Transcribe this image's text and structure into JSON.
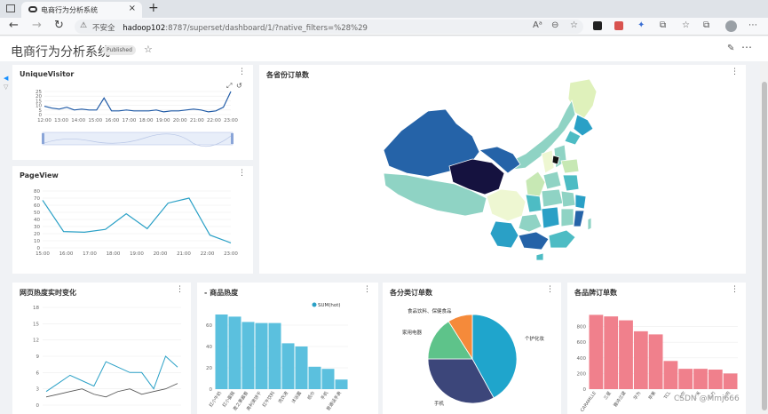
{
  "browser": {
    "tab_title": "电商行为分析系统",
    "tab_close": "×",
    "new_tab": "+",
    "insecure_label": "不安全",
    "url_host": "hadoop102",
    "url_path": ":8787/superset/dashboard/1/?native_filters=%28%29",
    "nav_back": "←",
    "nav_forward": "→",
    "nav_reload": "↻"
  },
  "dashboard": {
    "title": "电商行为分析系统",
    "status_badge": "Published",
    "star_icon": "☆",
    "edit_icon": "✎",
    "menu_icon": "⋯"
  },
  "menu_icon": "⋮",
  "charts": {
    "unique_visitor": {
      "title": "UniqueVisitor",
      "type": "line",
      "x": [
        "12:00",
        "13:00",
        "14:00",
        "15:00",
        "16:00",
        "17:00",
        "18:00",
        "19:00",
        "20:00",
        "21:00",
        "22:00",
        "23:00"
      ],
      "y_ticks": [
        "25",
        "20",
        "15",
        "10",
        "5",
        "0"
      ],
      "ylim": [
        0,
        25
      ],
      "values": [
        9,
        7,
        6,
        8,
        5,
        6,
        5,
        5,
        18,
        4,
        4,
        5,
        4,
        4,
        4,
        5,
        3,
        4,
        4,
        5,
        6,
        5,
        3,
        4,
        8,
        25
      ],
      "toolbox": [
        "⤢",
        "↺"
      ],
      "has_zoom_slider": true
    },
    "page_view": {
      "title": "PageView",
      "type": "line",
      "x": [
        "15:00",
        "16:00",
        "17:00",
        "18:00",
        "19:00",
        "20:00",
        "21:00",
        "22:00",
        "23:00"
      ],
      "y_ticks": [
        "80",
        "70",
        "60",
        "50",
        "40",
        "30",
        "20",
        "10",
        "0"
      ],
      "ylim": [
        0,
        80
      ],
      "values": [
        67,
        23,
        22,
        26,
        48,
        27,
        63,
        70,
        18,
        7
      ]
    },
    "province_orders": {
      "title": "各省份订单数",
      "type": "map"
    },
    "page_heat": {
      "title": "网页热度实时变化",
      "type": "line",
      "y_ticks": [
        "18",
        "15",
        "12",
        "9",
        "6",
        "3",
        "0"
      ],
      "ylim": [
        0,
        18
      ]
    },
    "product_heat": {
      "title": "- 商品热度",
      "type": "bar",
      "legend": "SUM(hot)",
      "categories": [
        "红小牛奶",
        "红小蛋糕",
        "麦之果酱香",
        "奥利奥饼干",
        "红牛饮料",
        "洗衣液",
        "沐浴露",
        "纸巾",
        "手机",
        "普通话手表"
      ],
      "values": [
        70,
        68,
        63,
        62,
        62,
        43,
        40,
        21,
        19,
        9
      ],
      "y_ticks": [
        "60",
        "40",
        "20",
        "0"
      ],
      "ylim": [
        0,
        75
      ]
    },
    "category_orders": {
      "title": "各分类订单数",
      "type": "pie",
      "labels": [
        "个护化妆",
        "手机",
        "家用电器",
        "食品饮料、保健食品"
      ],
      "values": [
        42,
        33,
        16,
        9
      ]
    },
    "brand_orders": {
      "title": "各品牌订单数",
      "type": "bar",
      "categories": [
        "CARAMLLE",
        "三星",
        "雅诗兰黛",
        "华为",
        "苹果",
        "TCL",
        "海尔",
        "小米",
        "格力",
        "美的"
      ],
      "values": [
        950,
        930,
        880,
        740,
        700,
        360,
        260,
        260,
        250,
        200
      ],
      "y_ticks": [
        "800",
        "600",
        "400",
        "200",
        "0"
      ],
      "ylim": [
        0,
        1000
      ]
    }
  },
  "watermark": "CSDN @Mmj666"
}
